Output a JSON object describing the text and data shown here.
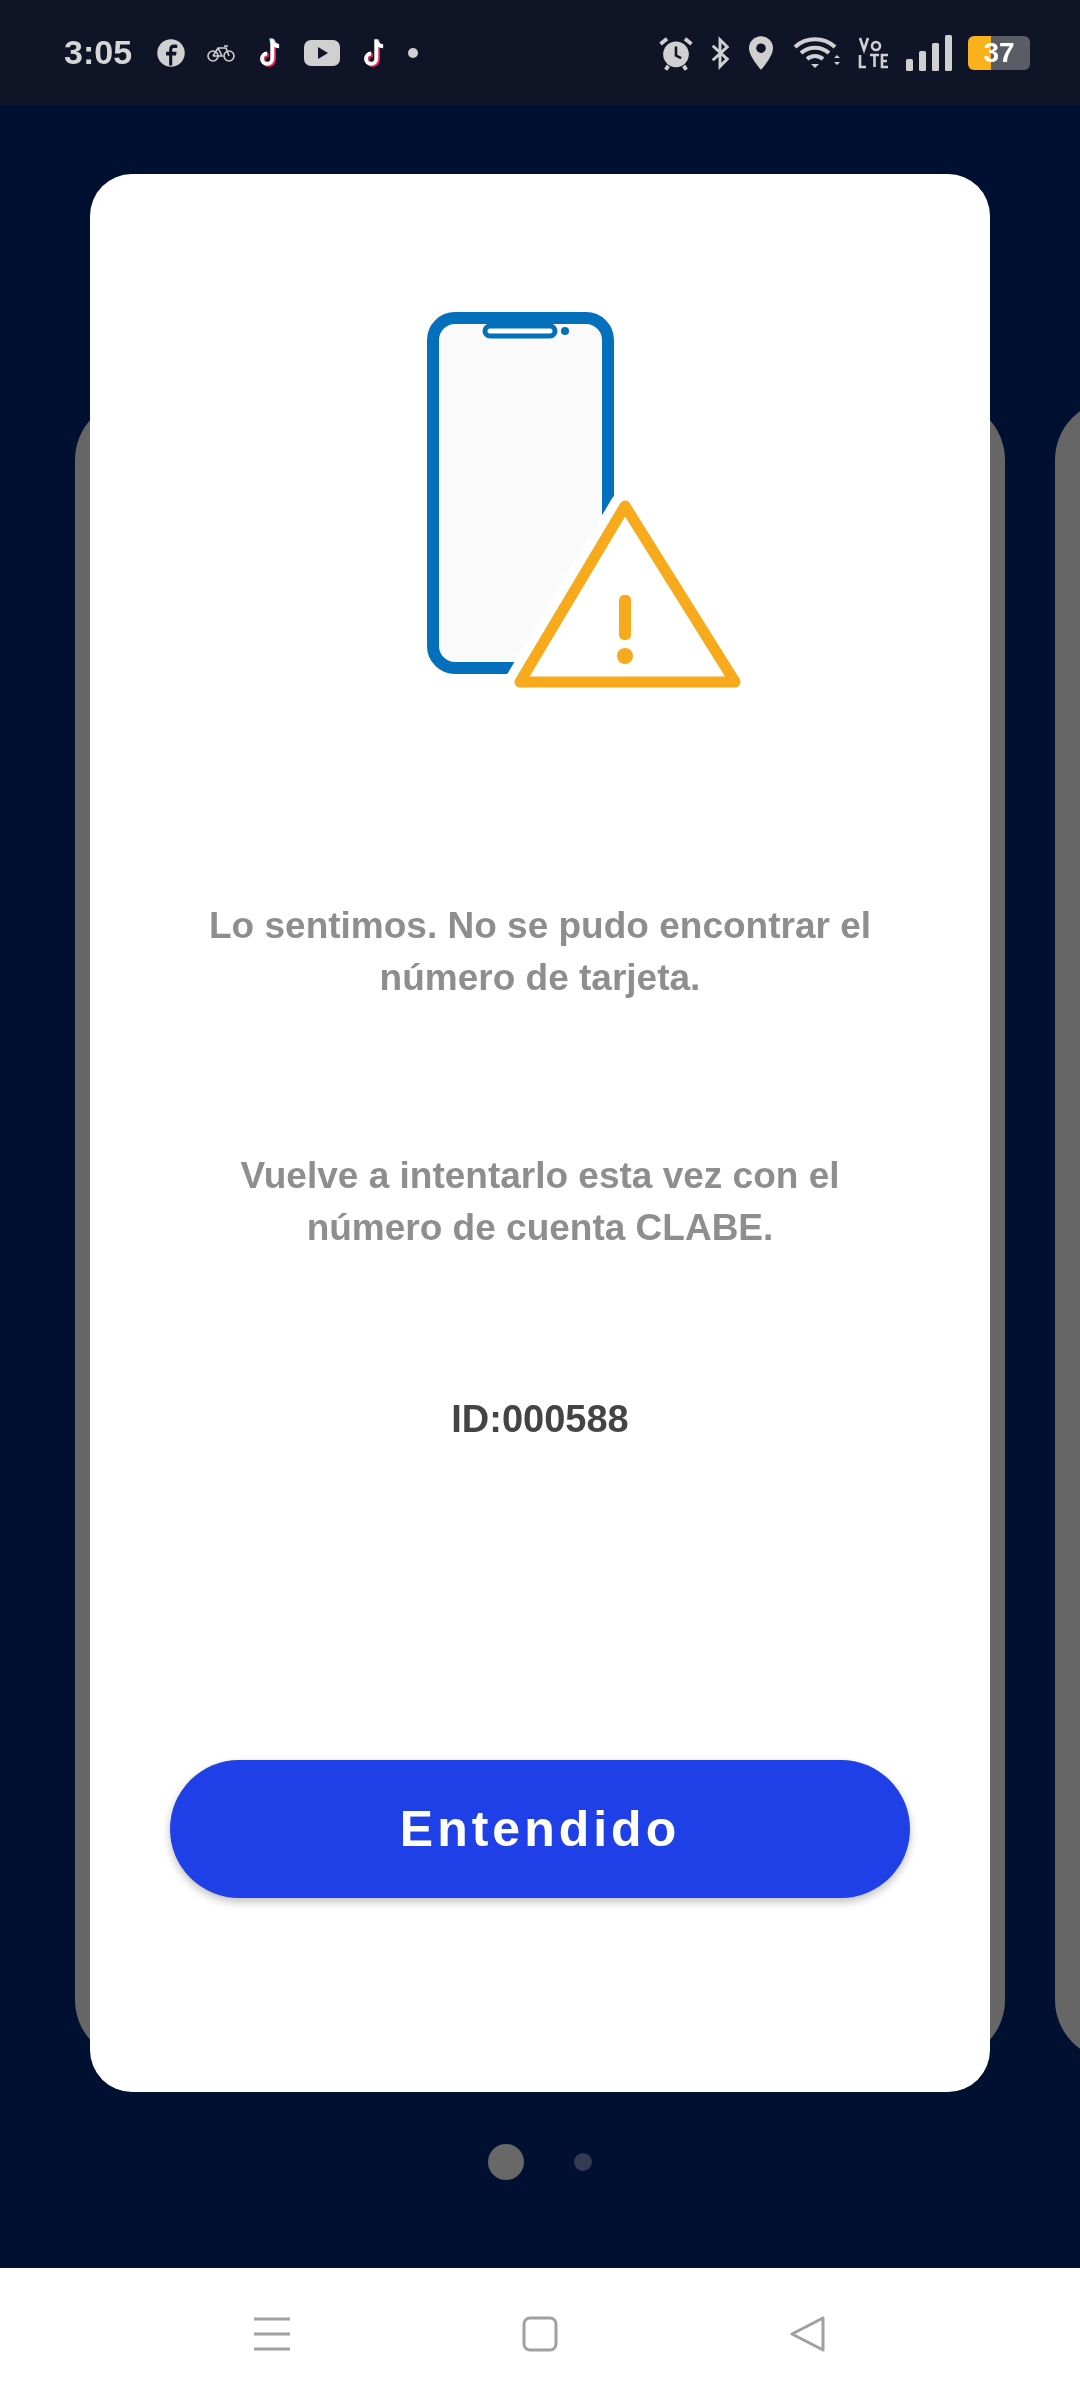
{
  "status_bar": {
    "time": "3:05",
    "battery": "37"
  },
  "dialog": {
    "message": "Lo sentimos. No se pudo encontrar el número de tarjeta.",
    "hint": "Vuelve a intentarlo esta vez con el número de cuenta CLABE.",
    "error_id": "ID:000588",
    "button": "Entendido"
  },
  "pager": [
    {
      "selected": true
    },
    {
      "selected": false
    }
  ]
}
